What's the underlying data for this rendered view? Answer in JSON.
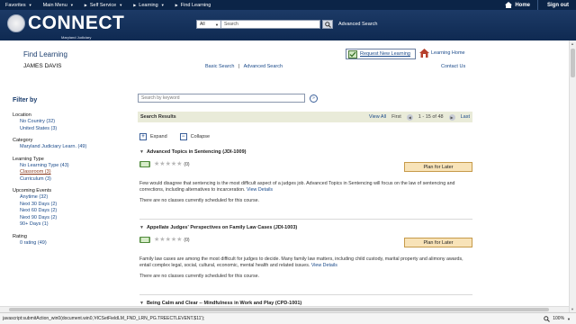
{
  "topnav": {
    "items": [
      {
        "label": "Favorites"
      },
      {
        "label": "Main Menu"
      },
      {
        "label": "Self Service"
      },
      {
        "label": "Learning"
      }
    ],
    "current": "Find Learning",
    "home": "Home",
    "signout": "Sign out"
  },
  "header": {
    "logo_text": "CONNECT",
    "logo_sub": "Maryland Judiciary",
    "search_scope": "All",
    "search_placeholder": "Search",
    "advanced_search": "Advanced Search"
  },
  "page": {
    "title": "Find Learning",
    "user": "JAMES DAVIS",
    "basic_search": "Basic Search",
    "separator": "|",
    "advanced_search": "Advanced Search",
    "request_new": "Request New Learning",
    "learning_home": "Learning Home",
    "contact_us": "Contact Us"
  },
  "filter": {
    "heading": "Filter by",
    "groups": [
      {
        "label": "Location",
        "options": [
          "No Country (32)",
          "United States (3)"
        ]
      },
      {
        "label": "Category",
        "options": [
          "Maryland Judiciary Learn. (49)"
        ]
      },
      {
        "label": "Learning Type",
        "options": [
          "No Learning Type (43)",
          "Classroom (3)",
          "Curriculum (3)"
        ]
      },
      {
        "label": "Upcoming Events",
        "options": [
          "Anytime (32)",
          "Next 30 Days (2)",
          "Next 60 Days (2)",
          "Next 90 Days (2)",
          "90+ Days (1)"
        ]
      },
      {
        "label": "Rating",
        "options": [
          "0 rating (49)"
        ]
      }
    ]
  },
  "keyword": {
    "placeholder": "Search by keyword"
  },
  "results": {
    "title": "Search Results",
    "view_all": "View All",
    "first": "First",
    "range": "1 - 15 of 48",
    "last": "Last"
  },
  "expand": "Expand",
  "collapse": "Collapse",
  "courses": [
    {
      "title": "Advanced Topics in Sentencing (JDI-1009)",
      "count": "(0)",
      "plan": "Plan for Later",
      "desc": "Few would disagree that sentencing is the most difficult aspect of a judges job. Advanced Topics in Sentencing will focus on the law of sentencing and corrections, including alternatives to incarceration.",
      "view": "View Details",
      "no_classes": "There are no classes currently scheduled for this course."
    },
    {
      "title": "Appellate Judges' Perspectives on Family Law Cases (JDI-1003)",
      "count": "(0)",
      "plan": "Plan for Later",
      "desc": "Family law cases are among the most difficult for judges to decide. Many family law matters, including child custody, marital property and alimony awards, entail complex legal, social, cultural, economic, mental health and related issues.",
      "view": "View Details",
      "no_classes": "There are no classes currently scheduled for this course."
    },
    {
      "title": "Being Calm and Clear -- Mindfulness in Work and Play (CPD-1001)"
    }
  ],
  "status": {
    "text": "javascript:submitAction_win0(document.win0,'#ICSetFieldLM_FND_LRN_PG.TREECTLEVENT.$11');",
    "zoom": "100%"
  },
  "colors": {
    "nav": "#0b2447",
    "header": "#1c3a66",
    "link": "#1a4a8a",
    "plan_btn": "#f8e3b8"
  }
}
